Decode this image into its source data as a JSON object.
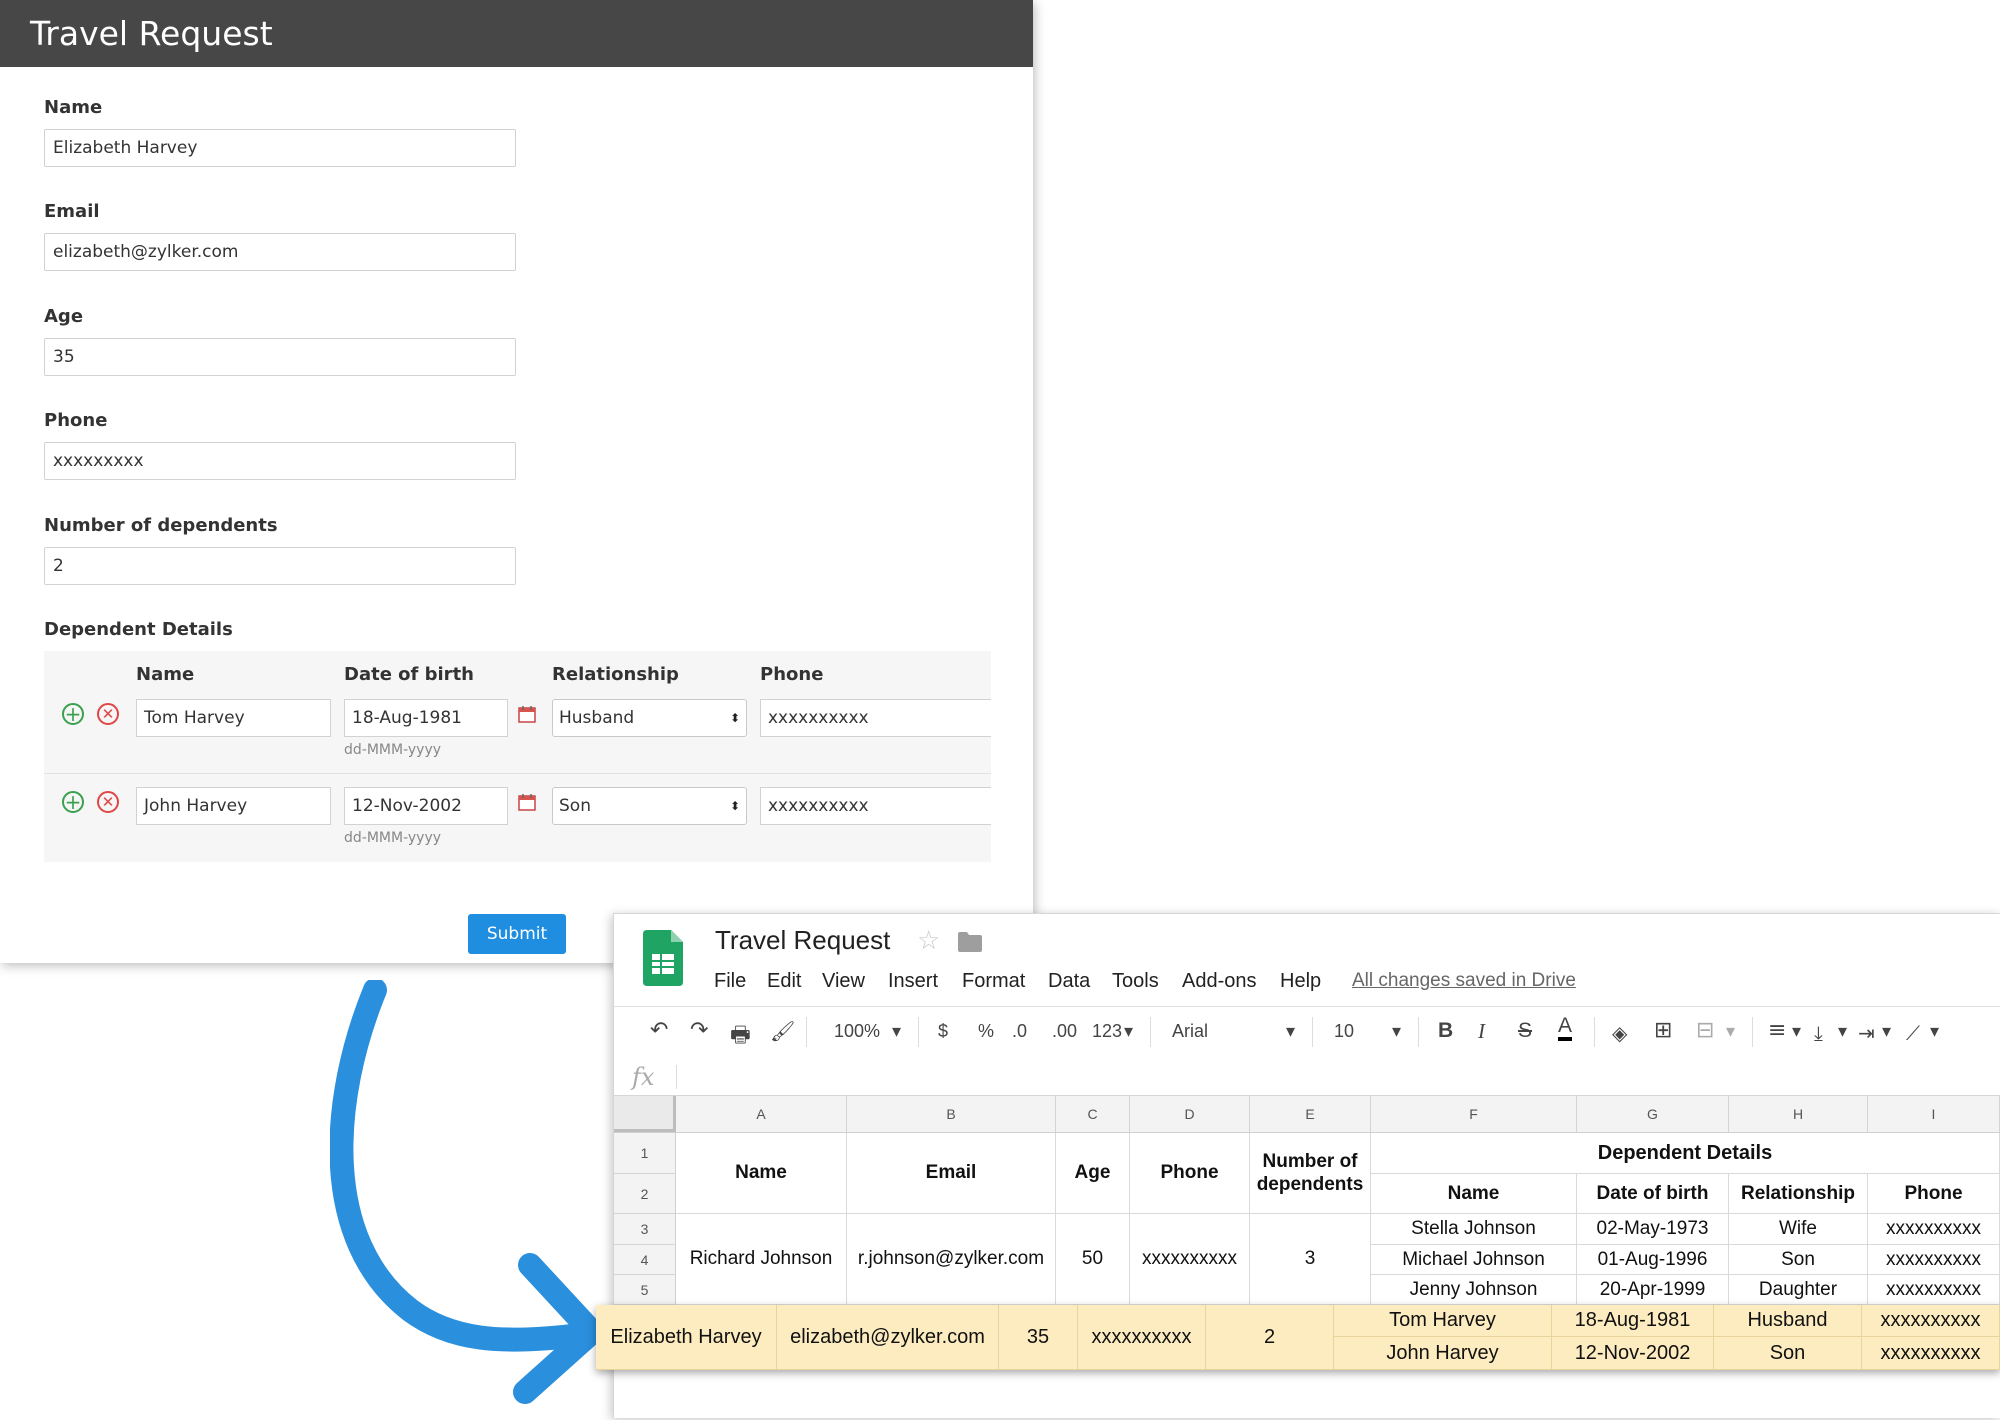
{
  "form": {
    "title": "Travel Request",
    "fields": {
      "name_label": "Name",
      "name_value": "Elizabeth Harvey",
      "email_label": "Email",
      "email_value": "elizabeth@zylker.com",
      "age_label": "Age",
      "age_value": "35",
      "phone_label": "Phone",
      "phone_value": "xxxxxxxxx",
      "dependents_label": "Number of dependents",
      "dependents_value": "2"
    },
    "dependent_section": {
      "title": "Dependent Details",
      "headers": [
        "Name",
        "Date of birth",
        "Relationship",
        "Phone"
      ],
      "rows": [
        {
          "name": "Tom Harvey",
          "dob": "18-Aug-1981",
          "dob_hint": "dd-MMM-yyyy",
          "relationship": "Husband",
          "phone": "xxxxxxxxxx"
        },
        {
          "name": "John Harvey",
          "dob": "12-Nov-2002",
          "dob_hint": "dd-MMM-yyyy",
          "relationship": "Son",
          "phone": "xxxxxxxxxx"
        }
      ],
      "add_symbol": "+",
      "remove_symbol": "✕",
      "select_arrow": "⬍"
    },
    "submit_label": "Submit"
  },
  "sheet": {
    "title": "Travel Request",
    "star_symbol": "☆",
    "menu": [
      "File",
      "Edit",
      "View",
      "Insert",
      "Format",
      "Data",
      "Tools",
      "Add-ons",
      "Help"
    ],
    "saved_status": "All changes saved in Drive",
    "toolbar": {
      "zoom": "100%",
      "currency": "$",
      "percent": "%",
      "dec_decrease": ".0",
      "dec_increase": ".00",
      "number_format": "123",
      "font": "Arial",
      "font_size": "10",
      "bold": "B",
      "italic": "I",
      "strike": "S",
      "text_color": "A",
      "dropdown_symbol": "▾",
      "undo_symbol": "↶",
      "redo_symbol": "↷",
      "print_symbol": "🖶",
      "paint_symbol": "🖌",
      "fill_symbol": "◈",
      "borders_symbol": "⊞",
      "merge_symbol": "⊟",
      "align_symbol": "≡",
      "valign_symbol": "⤓",
      "wrap_symbol": "⇥",
      "rotate_symbol": "⟋"
    },
    "formula_label": "fx",
    "columns": [
      "A",
      "B",
      "C",
      "D",
      "E",
      "F",
      "G",
      "H",
      "I"
    ],
    "row_numbers": [
      "1",
      "2",
      "3",
      "4",
      "5"
    ],
    "headers": {
      "name": "Name",
      "email": "Email",
      "age": "Age",
      "phone": "Phone",
      "num_dependents": "Number of dependents",
      "dependent_details": "Dependent Details",
      "dep_name": "Name",
      "dep_dob": "Date of birth",
      "dep_relationship": "Relationship",
      "dep_phone": "Phone"
    },
    "records": [
      {
        "name": "Richard Johnson",
        "email": "r.johnson@zylker.com",
        "age": "50",
        "phone": "xxxxxxxxxx",
        "num_dependents": "3",
        "dependents": [
          {
            "name": "Stella Johnson",
            "dob": "02-May-1973",
            "relationship": "Wife",
            "phone": "xxxxxxxxxx"
          },
          {
            "name": "Michael Johnson",
            "dob": "01-Aug-1996",
            "relationship": "Son",
            "phone": "xxxxxxxxxx"
          },
          {
            "name": "Jenny Johnson",
            "dob": "20-Apr-1999",
            "relationship": "Daughter",
            "phone": "xxxxxxxxxx"
          }
        ]
      },
      {
        "name": "Elizabeth Harvey",
        "email": "elizabeth@zylker.com",
        "age": "35",
        "phone": "xxxxxxxxxx",
        "num_dependents": "2",
        "dependents": [
          {
            "name": "Tom Harvey",
            "dob": "18-Aug-1981",
            "relationship": "Husband",
            "phone": "xxxxxxxxxx"
          },
          {
            "name": "John Harvey",
            "dob": "12-Nov-2002",
            "relationship": "Son",
            "phone": "xxxxxxxxxx"
          }
        ]
      }
    ]
  },
  "colors": {
    "form_header_bg": "#474747",
    "submit_bg": "#1f8de0",
    "arrow": "#2a8fdc",
    "sheets_green": "#1fa463",
    "highlight_row": "#fdecc0"
  }
}
